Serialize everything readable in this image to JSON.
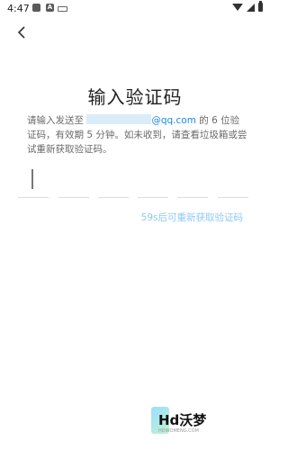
{
  "status_bar": {
    "time": "4:47",
    "notification_icons": [
      "gallery-icon",
      "a-icon",
      "card-icon"
    ],
    "system_icons": [
      "wifi-icon",
      "signal-icon",
      "battery-icon"
    ]
  },
  "header": {
    "back_icon": "chevron-left-icon"
  },
  "main": {
    "title": "输入验证码",
    "description": {
      "prefix": "请输入发送至 ",
      "email_visible": "@qq.com",
      "suffix": " 的 6 位验证码，有效期 5 分钟。如未收到，请查看垃圾箱或尝试重新获取验证码。"
    },
    "code_inputs": [
      "",
      "",
      "",
      "",
      "",
      ""
    ],
    "resend_text": "59s后可重新获取验证码"
  },
  "watermark": {
    "text": "Hd沃梦",
    "subtext": "HDWOMENG.COM"
  },
  "colors": {
    "accent": "#1e88e5",
    "resend_disabled": "#8ec9f5",
    "masked_email_bg": "#d9ecf8"
  }
}
